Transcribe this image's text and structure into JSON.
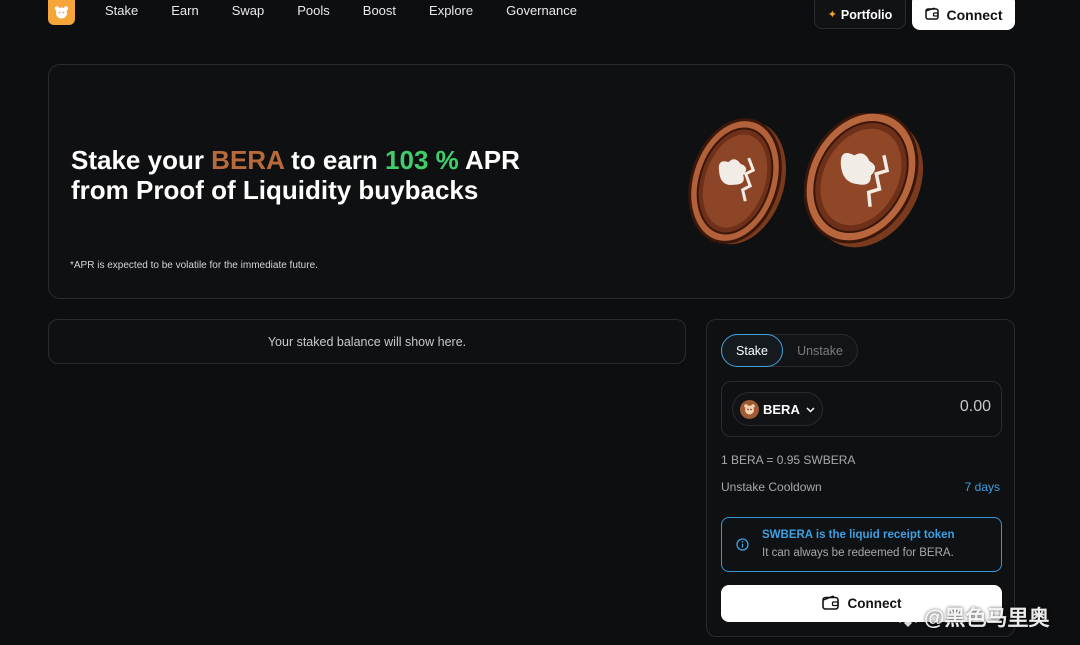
{
  "nav": {
    "links": [
      "Stake",
      "Earn",
      "Swap",
      "Pools",
      "Boost",
      "Explore",
      "Governance"
    ],
    "portfolio_label": "Portfolio",
    "connect_label": "Connect"
  },
  "hero": {
    "title_part1": "Stake your ",
    "title_token": "BERA",
    "title_part2": " to earn ",
    "title_apr": "103 %",
    "title_part3": " APR",
    "title_line2": "from Proof of Liquidity buybacks",
    "note": "*APR is expected to be volatile for the immediate future."
  },
  "balance": {
    "empty_text": "Your staked balance will show here."
  },
  "stake_panel": {
    "tabs": [
      "Stake",
      "Unstake"
    ],
    "active_tab": "Stake",
    "token": "BERA",
    "amount_placeholder": "0.00",
    "rate": "1 BERA = 0.95 SWBERA",
    "cooldown_label": "Unstake Cooldown",
    "cooldown_value": "7 days",
    "info_title": "SWBERA is the liquid receipt token",
    "info_text": "It can always be redeemed for BERA.",
    "connect_label": "Connect"
  },
  "watermark": {
    "text": "@黑色马里奥"
  },
  "colors": {
    "background": "#0d0e10",
    "bera_accent": "#b86a3a",
    "apr_green": "#3ecf6b",
    "info_blue": "#3f9fe0",
    "logo_orange": "#f6a53b"
  },
  "icons": [
    "logo-icon",
    "sparkle-icon",
    "wallet-icon",
    "bera-token-icon",
    "chevron-down-icon",
    "info-icon",
    "coin-icon"
  ]
}
